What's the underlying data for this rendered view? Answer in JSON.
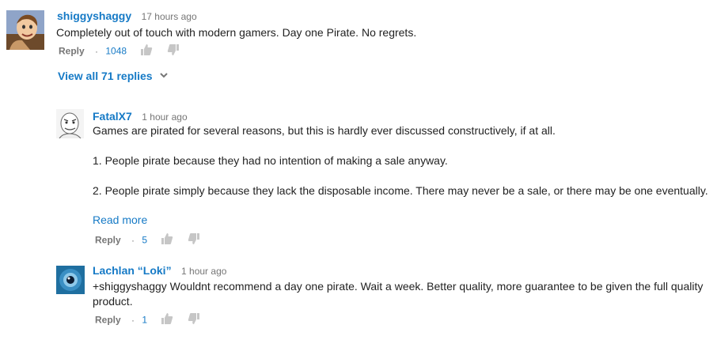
{
  "comments": [
    {
      "author": "shiggyshaggy",
      "time": "17 hours ago",
      "text": "Completely out of touch with modern gamers. Day one Pirate. No regrets.",
      "reply_label": "Reply",
      "likes": "1048",
      "view_replies": "View all 71 replies"
    },
    {
      "author": "FatalX7",
      "time": "1 hour ago",
      "paragraphs": [
        "Games are pirated for several reasons, but this is hardly ever discussed constructively, if at all.",
        "1. People pirate because they had no intention of making a sale anyway.",
        "2. People pirate simply because they lack the disposable income. There may never be a sale, or there may be one eventually."
      ],
      "read_more": "Read more",
      "reply_label": "Reply",
      "likes": "5"
    },
    {
      "author": "Lachlan “Loki”",
      "time": "1 hour ago",
      "text": "+shiggyshaggy Wouldnt recommend a day one pirate. Wait a week. Better quality, more guarantee to be given the full quality product.",
      "reply_label": "Reply",
      "likes": "1"
    }
  ],
  "colors": {
    "link": "#167ac6",
    "muted": "#767676",
    "thumb": "#c6c6c6"
  },
  "icons": [
    "thumbs-up-icon",
    "thumbs-down-icon",
    "chevron-down-icon"
  ]
}
